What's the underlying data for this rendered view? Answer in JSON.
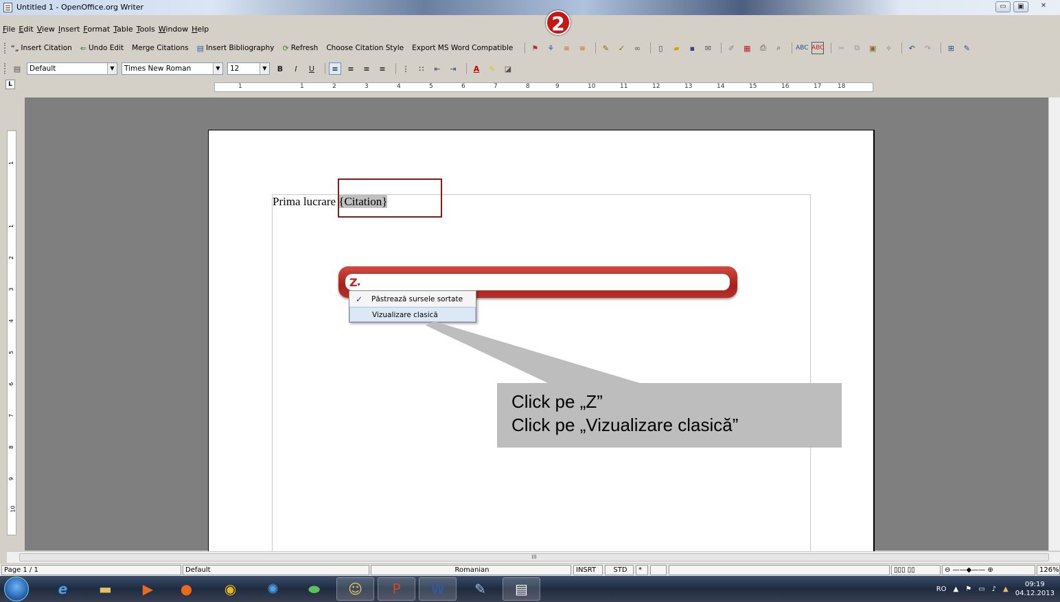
{
  "window": {
    "title": "Untitled 1 - OpenOffice.org Writer",
    "controls": [
      "minimize",
      "maximize",
      "close"
    ]
  },
  "menu": [
    "File",
    "Edit",
    "View",
    "Insert",
    "Format",
    "Table",
    "Tools",
    "Window",
    "Help"
  ],
  "zotero_toolbar": {
    "insert_citation": "Insert Citation",
    "undo_edit": "Undo Edit",
    "merge_citations": "Merge Citations",
    "insert_bibliography": "Insert Bibliography",
    "refresh": "Refresh",
    "choose_citation_style": "Choose Citation Style",
    "export_ms_word": "Export MS Word Compatible"
  },
  "format_toolbar": {
    "paragraph_style": "Default",
    "font_name": "Times New Roman",
    "font_size": "12"
  },
  "ruler": {
    "h_ticks": [
      "1",
      "1",
      "2",
      "3",
      "4",
      "5",
      "6",
      "7",
      "8",
      "9",
      "10",
      "11",
      "12",
      "13",
      "14",
      "15",
      "16",
      "17",
      "18"
    ],
    "v_ticks": [
      "1",
      "1",
      "2",
      "3",
      "4",
      "5",
      "6",
      "7",
      "8",
      "9",
      "10"
    ]
  },
  "document": {
    "text_before": "Prima lucrare ",
    "citation_field": "{Citation}"
  },
  "zotero_popup": {
    "logo": "Z",
    "menu_items": [
      {
        "label": "Păstrează sursele sortate",
        "checked": true
      },
      {
        "label": "Vizualizare clasică",
        "checked": false
      }
    ]
  },
  "callout": {
    "line1": "Click pe „Z”",
    "line2": "Click pe „Vizualizare clasică”"
  },
  "step_badge": "2",
  "statusbar": {
    "page": "Page 1 / 1",
    "style": "Default",
    "language": "Romanian",
    "insert_mode": "INSRT",
    "selection_mode": "STD",
    "modified": "*",
    "zoom": "126%"
  },
  "taskbar": {
    "language": "RO",
    "time": "09:19",
    "date": "04.12.2013"
  }
}
